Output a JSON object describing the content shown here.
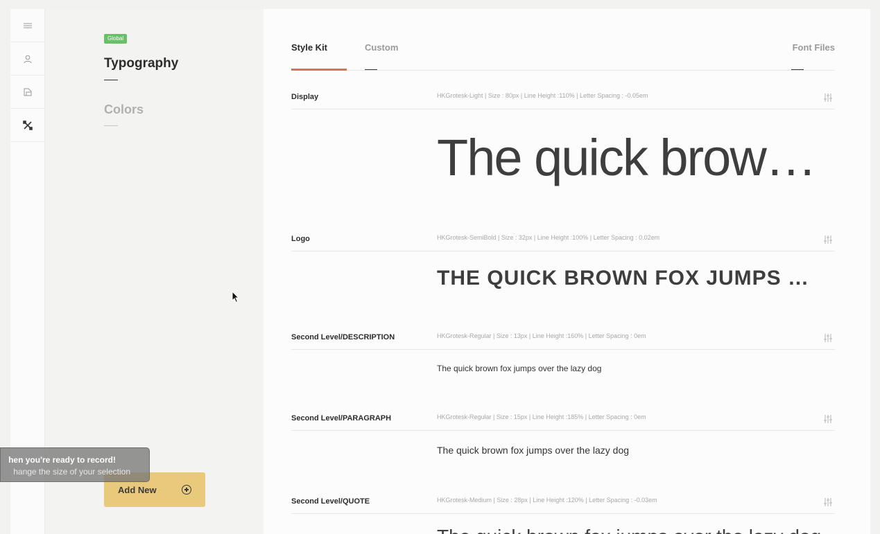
{
  "rail": {
    "items": [
      {
        "icon": "list-icon"
      },
      {
        "icon": "user-icon"
      },
      {
        "icon": "pages-icon"
      },
      {
        "icon": "design-tools-icon"
      }
    ]
  },
  "side": {
    "badge": "Global",
    "title": "Typography",
    "colors": "Colors",
    "add_button": "Add New"
  },
  "tabs": {
    "style_kit": "Style Kit",
    "custom": "Custom",
    "font_files": "Font Files"
  },
  "styles": [
    {
      "label": "Display",
      "meta": "HKGrotesk-Light | Size : 80px | Line Height :110% | Letter Spacing : -0.05em",
      "sample": "The quick brown fox jumps over the lazy dog"
    },
    {
      "label": "Logo",
      "meta": "HKGrotesk-SemiBold | Size : 32px | Line Height :100% | Letter Spacing : 0.02em",
      "sample": "THE QUICK BROWN FOX JUMPS OVER THE LAZY DOG"
    },
    {
      "label": "Second Level/DESCRIPTION",
      "meta": "HKGrotesk-Regular | Size : 13px | Line Height :160% | Letter Spacing : 0em",
      "sample": "The quick brown fox jumps over the lazy dog"
    },
    {
      "label": "Second Level/PARAGRAPH",
      "meta": "HKGrotesk-Regular | Size : 15px | Line Height :185% | Letter Spacing : 0em",
      "sample": "The quick brown fox jumps over the lazy dog"
    },
    {
      "label": "Second Level/QUOTE",
      "meta": "HKGrotesk-Medium | Size : 28px | Line Height :120% | Letter Spacing : -0.03em",
      "sample": "The quick brown fox jumps over the lazy dog"
    }
  ],
  "record_tip": {
    "line1": "hen you're ready to record!",
    "line2": "hange the size of your selection"
  },
  "colors": {
    "accent": "#d9744f",
    "badge": "#6cbf6a",
    "add_button": "#e9c97c"
  }
}
